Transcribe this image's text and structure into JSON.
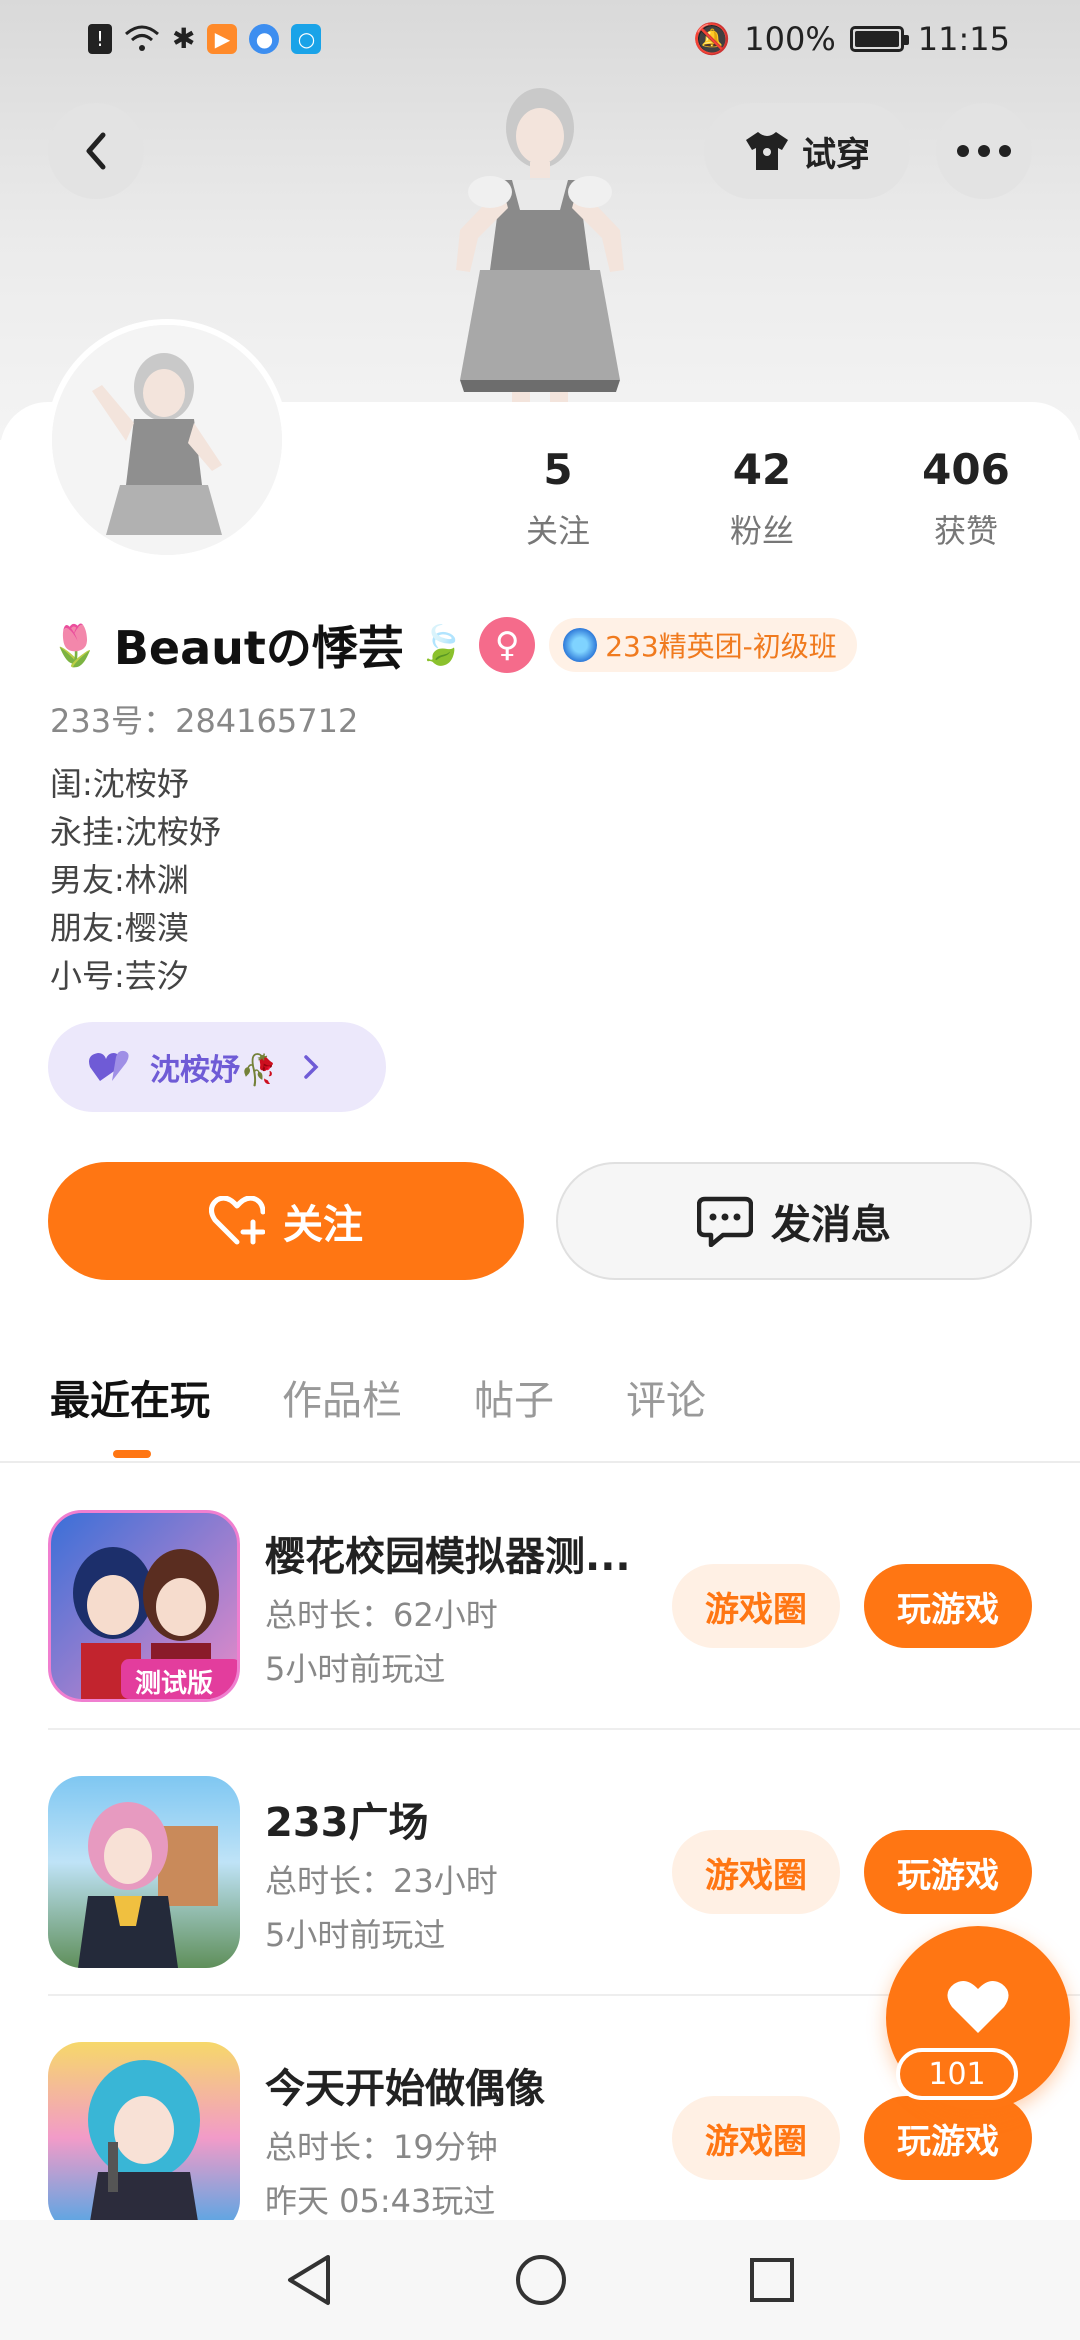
{
  "status_bar": {
    "battery": "100%",
    "time": "11:15"
  },
  "header": {
    "try_on_label": "试穿"
  },
  "profile": {
    "name": "Beautの悸芸",
    "gender_symbol": "♀",
    "badge_text": "233精英团-初级班",
    "uid": "233号：284165712",
    "bio_lines": [
      "闺:沈桉妤",
      "永挂:沈桉妤",
      "男友:林渊",
      "朋友:樱漠",
      "小号:芸汐"
    ],
    "cp_name": "沈桉妤🥀",
    "stats": [
      {
        "value": "5",
        "label": "关注"
      },
      {
        "value": "42",
        "label": "粉丝"
      },
      {
        "value": "406",
        "label": "获赞"
      }
    ]
  },
  "actions": {
    "follow_label": "关注",
    "message_label": "发消息"
  },
  "tabs": [
    "最近在玩",
    "作品栏",
    "帖子",
    "评论"
  ],
  "games": [
    {
      "title": "樱花校园模拟器测...",
      "duration": "总时长：62小时",
      "last_played": "5小时前玩过",
      "icon_badge": "测试版"
    },
    {
      "title": "233广场",
      "duration": "总时长：23小时",
      "last_played": "5小时前玩过"
    },
    {
      "title": "今天开始做偶像",
      "duration": "总时长：19分钟",
      "last_played": "昨天 05:43玩过"
    }
  ],
  "game_buttons": {
    "circle_label": "游戏圈",
    "play_label": "玩游戏"
  },
  "like_fab": {
    "count": "101"
  },
  "colors": {
    "accent": "#ff7613",
    "accent_light": "#fff0e4",
    "cp_purple": "#6f5bd6",
    "gender_pink": "#f56b8b"
  }
}
